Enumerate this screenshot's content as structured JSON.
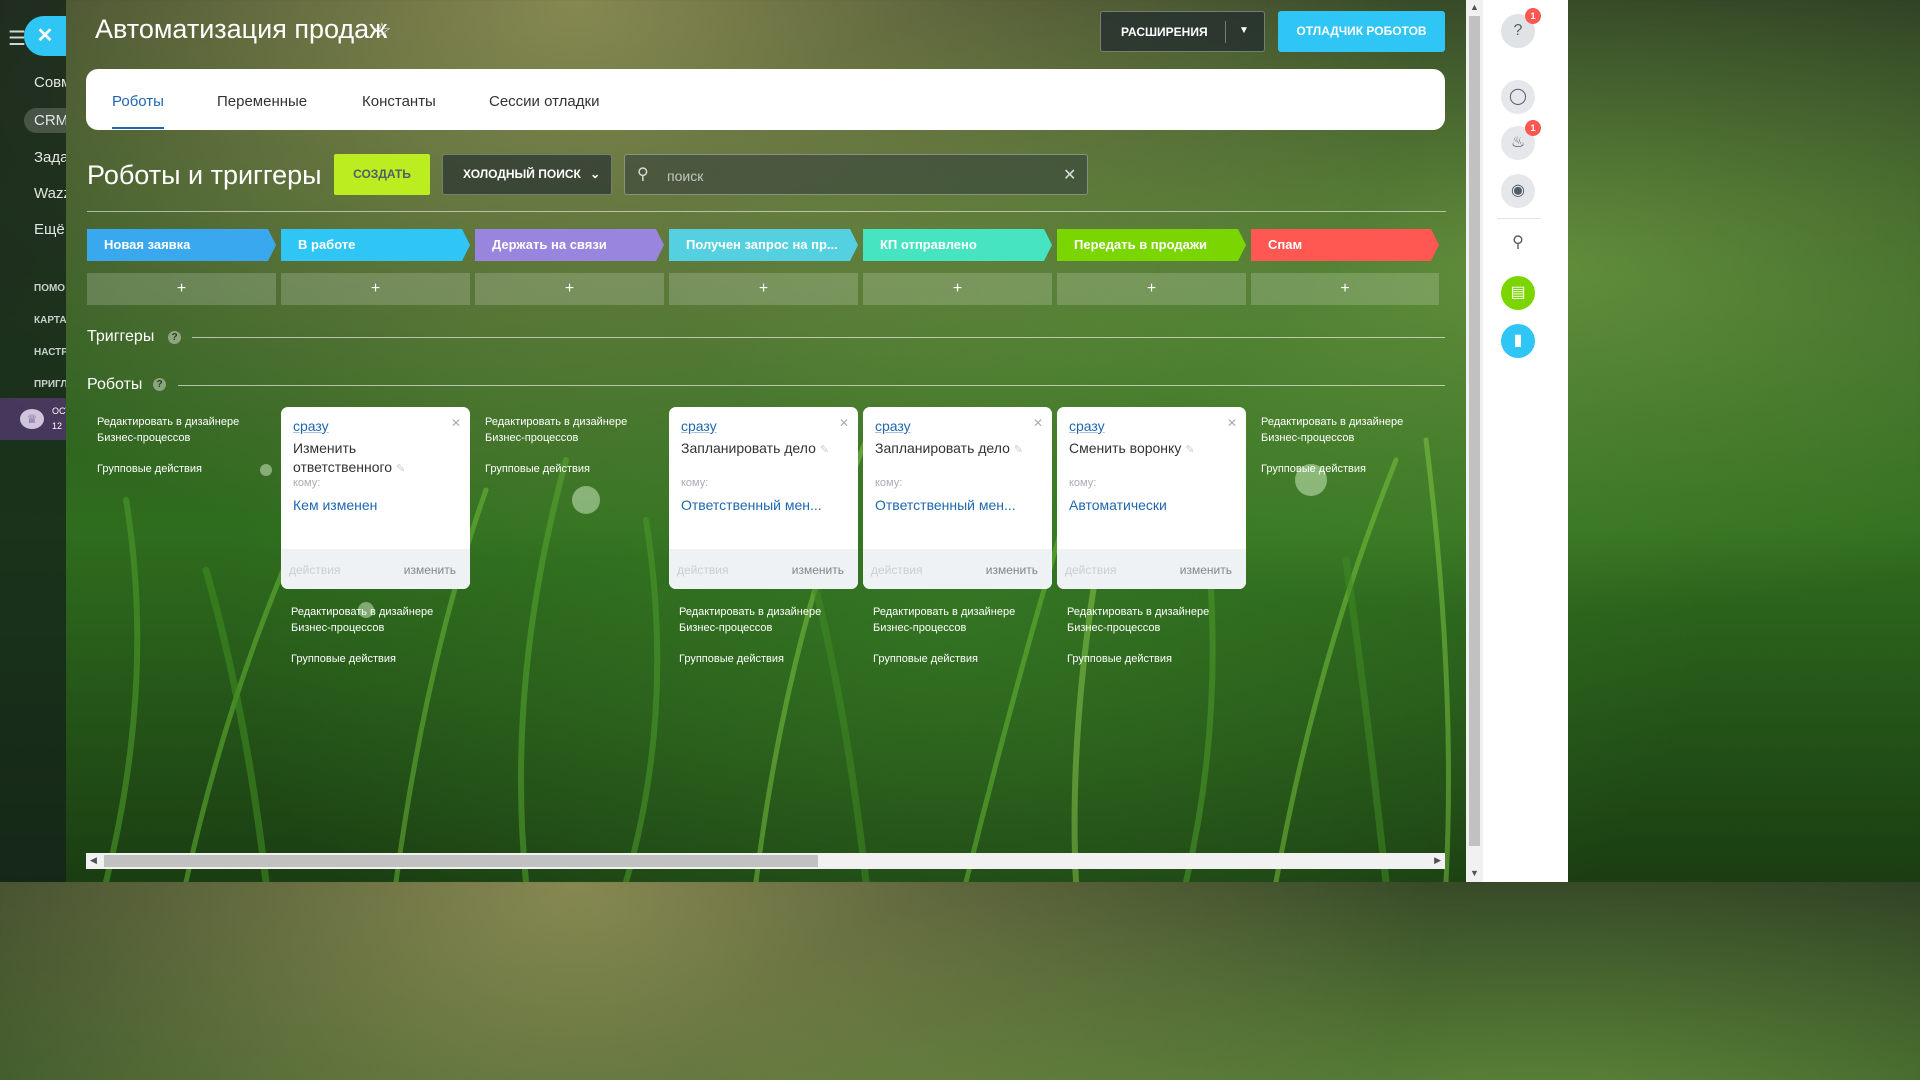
{
  "left_nav": {
    "items": [
      "Совм",
      "CRM",
      "Зада",
      "Wazz",
      "Ещё"
    ],
    "small_items": [
      "ПОМО",
      "КАРТА",
      "НАСТР",
      "ПРИГЛ"
    ],
    "promo_lines": [
      "ОСТ",
      "12"
    ]
  },
  "header": {
    "title": "Автоматизация продаж",
    "extensions_label": "РАСШИРЕНИЯ",
    "debugger_label": "ОТЛАДЧИК РОБОТОВ"
  },
  "tabs": [
    {
      "label": "Роботы",
      "active": true
    },
    {
      "label": "Переменные",
      "active": false
    },
    {
      "label": "Константы",
      "active": false
    },
    {
      "label": "Сессии отладки",
      "active": false
    }
  ],
  "toolbar": {
    "section_title": "Роботы и триггеры",
    "create_label": "СОЗДАТЬ",
    "filter_label": "ХОЛОДНЫЙ ПОИСК",
    "search_placeholder": "поиск"
  },
  "stages": [
    {
      "label": "Новая заявка",
      "color": "#39a8ef"
    },
    {
      "label": "В работе",
      "color": "#2fc6f6"
    },
    {
      "label": "Держать на связи",
      "color": "#9985dd"
    },
    {
      "label": "Получен запрос на пр...",
      "color": "#55d0e0"
    },
    {
      "label": "КП отправлено",
      "color": "#47e4c2"
    },
    {
      "label": "Передать в продажи",
      "color": "#7bd500"
    },
    {
      "label": "Спам",
      "color": "#ff5752"
    }
  ],
  "add_symbol": "+",
  "triggers_title": "Триггеры",
  "robots_title": "Роботы",
  "links": {
    "edit_designer": "Редактировать в дизайнере Бизнес-процессов",
    "group_actions": "Групповые действия"
  },
  "robots": [
    {
      "when": "сразу",
      "title": "Изменить ответственного",
      "to_label": "кому:",
      "to_value": "Кем изменен",
      "actions": "действия",
      "change": "изменить"
    },
    {
      "when": "сразу",
      "title": "Запланировать дело",
      "to_label": "кому:",
      "to_value": "Ответственный мен...",
      "actions": "действия",
      "change": "изменить"
    },
    {
      "when": "сразу",
      "title": "Запланировать дело",
      "to_label": "кому:",
      "to_value": "Ответственный мен...",
      "actions": "действия",
      "change": "изменить"
    },
    {
      "when": "сразу",
      "title": "Сменить воронку",
      "to_label": "кому:",
      "to_value": "Автоматически",
      "actions": "действия",
      "change": "изменить"
    }
  ],
  "right_panel": {
    "badges": {
      "help": "1",
      "notifications": "1"
    }
  },
  "colors": {
    "accent": "#2fc6f6",
    "create": "#bbed21",
    "link": "#2067b0",
    "badge": "#ff5752"
  }
}
